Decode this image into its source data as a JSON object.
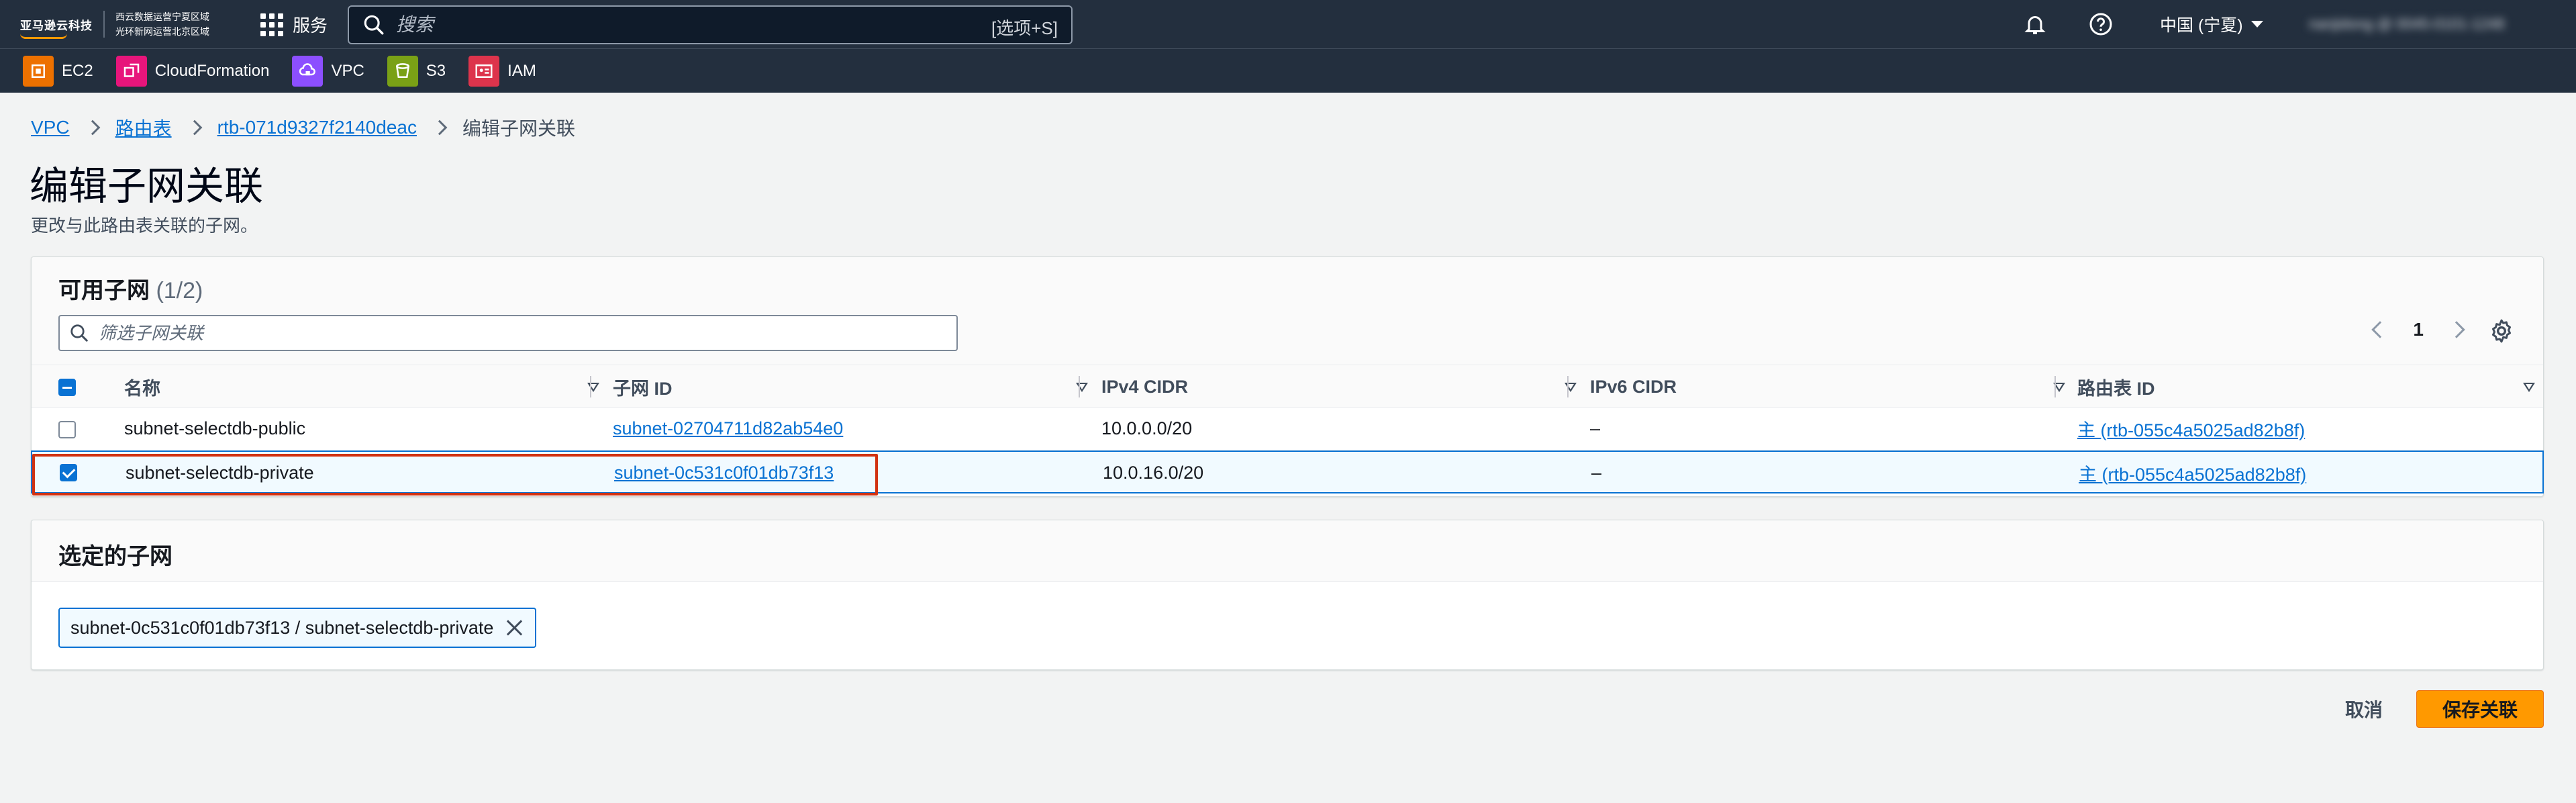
{
  "topnav": {
    "brand_main": "亚马逊云科技",
    "brand_sub1": "西云数据运营宁夏区域",
    "brand_sub2": "光环新网运营北京区域",
    "services_label": "服务",
    "search_placeholder": "搜索",
    "search_hint": "[选项+S]",
    "region_label": "中国 (宁夏)",
    "account_label": "nanjidong @ 0045-0101-1248"
  },
  "favorites": [
    {
      "label": "EC2",
      "color": "#ed7100"
    },
    {
      "label": "CloudFormation",
      "color": "#e7157b"
    },
    {
      "label": "VPC",
      "color": "#8c4fff"
    },
    {
      "label": "S3",
      "color": "#7aa116"
    },
    {
      "label": "IAM",
      "color": "#dd344c"
    }
  ],
  "breadcrumb": {
    "items": [
      "VPC",
      "路由表",
      "rtb-071d9327f2140deac"
    ],
    "current": "编辑子网关联"
  },
  "header": {
    "title": "编辑子网关联",
    "description": "更改与此路由表关联的子网。"
  },
  "available": {
    "title": "可用子网",
    "count": "(1/2)",
    "filter_placeholder": "筛选子网关联",
    "page": "1",
    "columns": [
      "名称",
      "子网 ID",
      "IPv4 CIDR",
      "IPv6 CIDR",
      "路由表 ID"
    ],
    "rows": [
      {
        "name": "subnet-selectdb-public",
        "subnet_id": "subnet-02704711d82ab54e0",
        "ipv4": "10.0.0.0/20",
        "ipv6": "–",
        "rtb": "主 (rtb-055c4a5025ad82b8f)",
        "selected": false
      },
      {
        "name": "subnet-selectdb-private",
        "subnet_id": "subnet-0c531c0f01db73f13",
        "ipv4": "10.0.16.0/20",
        "ipv6": "–",
        "rtb": "主 (rtb-055c4a5025ad82b8f)",
        "selected": true
      }
    ]
  },
  "selected": {
    "title": "选定的子网",
    "token": "subnet-0c531c0f01db73f13 / subnet-selectdb-private"
  },
  "actions": {
    "cancel": "取消",
    "save": "保存关联"
  },
  "colors": {
    "nav_bg": "#232f3e",
    "link": "#0972d3",
    "primary": "#ff9900",
    "highlight": "#d13212"
  }
}
